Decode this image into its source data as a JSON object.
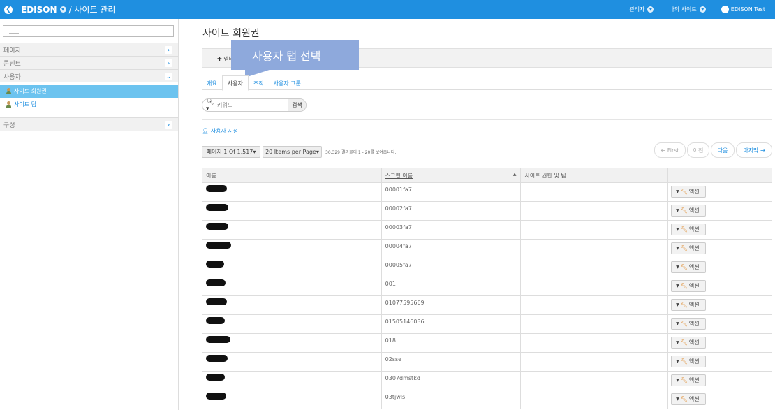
{
  "topbar": {
    "brand": "EDISON",
    "breadcrumb": "/ 사이트 관리",
    "admin": "관리자",
    "my_sites": "나의 사이트",
    "user": "EDISON Test"
  },
  "sidebar": {
    "sections": [
      {
        "label": "페이지"
      },
      {
        "label": "콘텐트"
      },
      {
        "label": "사용자"
      },
      {
        "label": "구성"
      }
    ],
    "items": [
      {
        "label": "사이트 회원권"
      },
      {
        "label": "사이트 팀"
      }
    ]
  },
  "main": {
    "title": "사이트 회원권",
    "add_member": "멤버 추가",
    "callout": "사용자 탭 선택",
    "tabs": [
      {
        "label": "개요"
      },
      {
        "label": "사용자"
      },
      {
        "label": "조직"
      },
      {
        "label": "사용자 그룹"
      }
    ],
    "search_placeholder": "키워드",
    "search_button": "검색",
    "assign_users": "사용자 지정",
    "page_select": "페이지 1 Of 1,517",
    "per_page": "20 Items per Page",
    "results_info": "30,329 결과물의 1 - 20를 보여줍니다.",
    "nav": {
      "first": "← First",
      "prev": "이전",
      "next": "다음",
      "last": "마지막 →"
    },
    "columns": [
      "이름",
      "스크린 이름",
      "사이트 권한 및 팀",
      ""
    ],
    "action_label": "액션",
    "rows": [
      {
        "screen_name": "00001fa7"
      },
      {
        "screen_name": "00002fa7"
      },
      {
        "screen_name": "00003fa7"
      },
      {
        "screen_name": "00004fa7"
      },
      {
        "screen_name": "00005fa7"
      },
      {
        "screen_name": "001"
      },
      {
        "screen_name": "01077595669"
      },
      {
        "screen_name": "01505146036"
      },
      {
        "screen_name": "018"
      },
      {
        "screen_name": "02sse"
      },
      {
        "screen_name": "0307dmstkd"
      },
      {
        "screen_name": "03tjwls"
      }
    ]
  },
  "colors": {
    "brand": "#1f8fe0",
    "active_item": "#6cc3ef",
    "callout": "#8ea9dc"
  },
  "icons": [
    "back-icon",
    "caret-down-icon",
    "chevron-right-icon",
    "chevron-down-icon",
    "user-icon",
    "search-icon",
    "plus-icon",
    "wrench-icon"
  ]
}
